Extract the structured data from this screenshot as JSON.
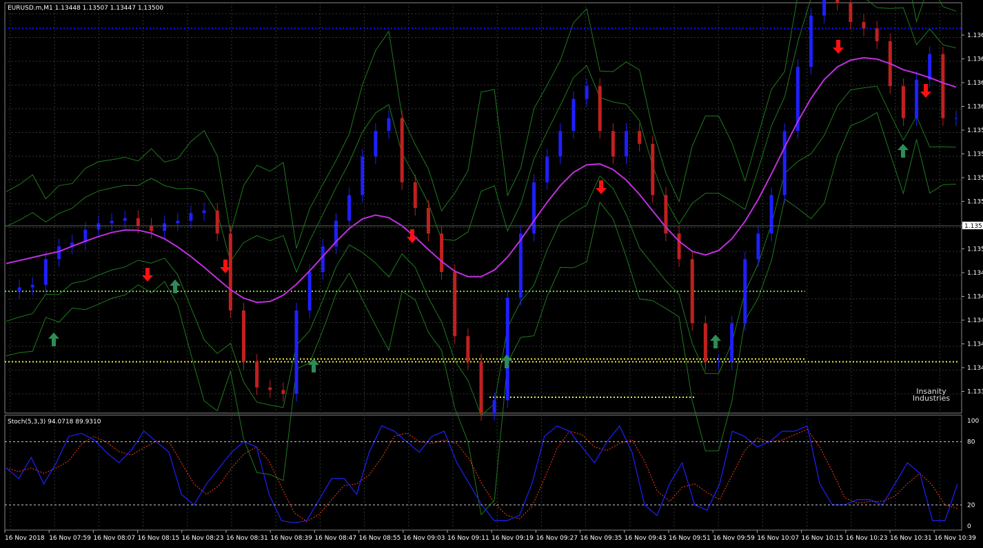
{
  "header": {
    "symbol_info": "EURUSD.m,M1  1.13448 1.13507 1.13447 1.13500"
  },
  "stoch_header": {
    "label": "Stoch(5,3,3) 94.0718 89.9310"
  },
  "watermark": {
    "line1": "Insanity",
    "line2": "Industries"
  },
  "colors": {
    "background": "#000000",
    "grid": "#2f3a2f",
    "bull_candle": "#1f1fff",
    "bear_candle": "#c02020",
    "ma_line": "#c030e0",
    "bands": "#1f7a1f",
    "buy_arrow": "#2e8b57",
    "sell_arrow": "#ff1010",
    "stoch_main": "#2020ff",
    "stoch_signal": "#ff4010",
    "level_blue": "#1010ff",
    "level_green": "#7fdc40",
    "level_yellow": "#f0f040"
  },
  "price_axis": {
    "ticks": [
      "1.136",
      "1.136",
      "1.136",
      "1.136",
      "1.135",
      "1.135",
      "1.135",
      "1.135",
      "1.135",
      "1.135",
      "1.134",
      "1.134",
      "1.134",
      "1.134",
      "1.134",
      "1.133",
      "1.133"
    ],
    "current": "1.135"
  },
  "stoch_axis": {
    "ticks": [
      "100",
      "80",
      "20",
      "0"
    ]
  },
  "time_axis": {
    "labels": [
      "16 Nov 2018",
      "16 Nov 07:59",
      "16 Nov 08:07",
      "16 Nov 08:15",
      "16 Nov 08:23",
      "16 Nov 08:31",
      "16 Nov 08:39",
      "16 Nov 08:47",
      "16 Nov 08:55",
      "16 Nov 09:03",
      "16 Nov 09:11",
      "16 Nov 09:19",
      "16 Nov 09:27",
      "16 Nov 09:35",
      "16 Nov 09:43",
      "16 Nov 09:51",
      "16 Nov 09:59",
      "16 Nov 10:07",
      "16 Nov 10:15",
      "16 Nov 10:23",
      "16 Nov 10:31",
      "16 Nov 10:39"
    ]
  },
  "chart_data": {
    "type": "candlestick",
    "symbol": "EURUSD.m",
    "timeframe": "M1",
    "price_range": [
      1.133,
      1.1362
    ],
    "stoch_range": [
      0,
      100
    ],
    "close_path": [
      1.13395,
      1.13398,
      1.134,
      1.1342,
      1.1343,
      1.13433,
      1.13443,
      1.13448,
      1.1345,
      1.13452,
      1.13446,
      1.13442,
      1.13448,
      1.1345,
      1.13456,
      1.13458,
      1.1344,
      1.1338,
      1.1334,
      1.1332,
      1.13318,
      1.13315,
      1.1338,
      1.1341,
      1.1343,
      1.1345,
      1.1347,
      1.135,
      1.1352,
      1.1353,
      1.1348,
      1.1346,
      1.1344,
      1.1341,
      1.1336,
      1.1334,
      1.133,
      1.1331,
      1.1339,
      1.1344,
      1.1348,
      1.135,
      1.1352,
      1.13545,
      1.13555,
      1.1352,
      1.135,
      1.1352,
      1.1351,
      1.1347,
      1.1344,
      1.1342,
      1.1337,
      1.1334,
      1.1334,
      1.1337,
      1.1342,
      1.1344,
      1.1347,
      1.1352,
      1.1357,
      1.1361,
      1.1363,
      1.1362,
      1.13605,
      1.136,
      1.1359,
      1.13555,
      1.1353,
      1.1356,
      1.1358,
      1.1353,
      1.1353
    ],
    "levels": {
      "blue": 1.136,
      "green_upper": 1.13645,
      "green_mid": 1.13395,
      "yellow_lower": 1.1334
    },
    "stoch_main": [
      55,
      45,
      65,
      40,
      60,
      85,
      88,
      82,
      70,
      60,
      72,
      90,
      80,
      70,
      30,
      20,
      40,
      55,
      70,
      80,
      75,
      30,
      5,
      3,
      5,
      25,
      45,
      45,
      30,
      70,
      95,
      90,
      80,
      70,
      85,
      90,
      60,
      40,
      20,
      5,
      5,
      10,
      40,
      85,
      95,
      90,
      75,
      60,
      80,
      95,
      70,
      20,
      10,
      40,
      60,
      20,
      15,
      40,
      90,
      85,
      75,
      80,
      90,
      90,
      95,
      40,
      20,
      20,
      25,
      25,
      20,
      40,
      60,
      50,
      5,
      5,
      40
    ]
  }
}
